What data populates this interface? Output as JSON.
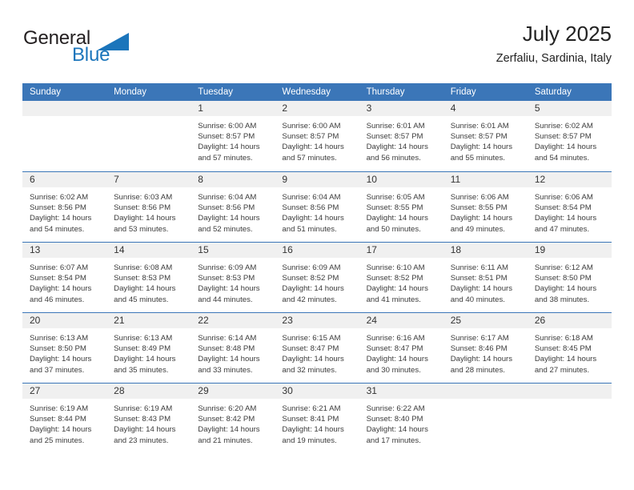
{
  "logo": {
    "word_top": "General",
    "word_bottom": "Blue",
    "triangle_color": "#1b75bb",
    "top_color": "#231f20",
    "bottom_color": "#1b75bb"
  },
  "header": {
    "title": "July 2025",
    "subtitle": "Zerfaliu, Sardinia, Italy"
  },
  "theme": {
    "header_blue": "#3b76b8",
    "day_band_gray": "#f0f0f0",
    "text": "#3b3b3b"
  },
  "weekdays": [
    "Sunday",
    "Monday",
    "Tuesday",
    "Wednesday",
    "Thursday",
    "Friday",
    "Saturday"
  ],
  "weeks": [
    [
      {
        "day": "",
        "sunrise": "",
        "sunset": "",
        "daylight_l1": "",
        "daylight_l2": ""
      },
      {
        "day": "",
        "sunrise": "",
        "sunset": "",
        "daylight_l1": "",
        "daylight_l2": ""
      },
      {
        "day": "1",
        "sunrise": "Sunrise: 6:00 AM",
        "sunset": "Sunset: 8:57 PM",
        "daylight_l1": "Daylight: 14 hours",
        "daylight_l2": "and 57 minutes."
      },
      {
        "day": "2",
        "sunrise": "Sunrise: 6:00 AM",
        "sunset": "Sunset: 8:57 PM",
        "daylight_l1": "Daylight: 14 hours",
        "daylight_l2": "and 57 minutes."
      },
      {
        "day": "3",
        "sunrise": "Sunrise: 6:01 AM",
        "sunset": "Sunset: 8:57 PM",
        "daylight_l1": "Daylight: 14 hours",
        "daylight_l2": "and 56 minutes."
      },
      {
        "day": "4",
        "sunrise": "Sunrise: 6:01 AM",
        "sunset": "Sunset: 8:57 PM",
        "daylight_l1": "Daylight: 14 hours",
        "daylight_l2": "and 55 minutes."
      },
      {
        "day": "5",
        "sunrise": "Sunrise: 6:02 AM",
        "sunset": "Sunset: 8:57 PM",
        "daylight_l1": "Daylight: 14 hours",
        "daylight_l2": "and 54 minutes."
      }
    ],
    [
      {
        "day": "6",
        "sunrise": "Sunrise: 6:02 AM",
        "sunset": "Sunset: 8:56 PM",
        "daylight_l1": "Daylight: 14 hours",
        "daylight_l2": "and 54 minutes."
      },
      {
        "day": "7",
        "sunrise": "Sunrise: 6:03 AM",
        "sunset": "Sunset: 8:56 PM",
        "daylight_l1": "Daylight: 14 hours",
        "daylight_l2": "and 53 minutes."
      },
      {
        "day": "8",
        "sunrise": "Sunrise: 6:04 AM",
        "sunset": "Sunset: 8:56 PM",
        "daylight_l1": "Daylight: 14 hours",
        "daylight_l2": "and 52 minutes."
      },
      {
        "day": "9",
        "sunrise": "Sunrise: 6:04 AM",
        "sunset": "Sunset: 8:56 PM",
        "daylight_l1": "Daylight: 14 hours",
        "daylight_l2": "and 51 minutes."
      },
      {
        "day": "10",
        "sunrise": "Sunrise: 6:05 AM",
        "sunset": "Sunset: 8:55 PM",
        "daylight_l1": "Daylight: 14 hours",
        "daylight_l2": "and 50 minutes."
      },
      {
        "day": "11",
        "sunrise": "Sunrise: 6:06 AM",
        "sunset": "Sunset: 8:55 PM",
        "daylight_l1": "Daylight: 14 hours",
        "daylight_l2": "and 49 minutes."
      },
      {
        "day": "12",
        "sunrise": "Sunrise: 6:06 AM",
        "sunset": "Sunset: 8:54 PM",
        "daylight_l1": "Daylight: 14 hours",
        "daylight_l2": "and 47 minutes."
      }
    ],
    [
      {
        "day": "13",
        "sunrise": "Sunrise: 6:07 AM",
        "sunset": "Sunset: 8:54 PM",
        "daylight_l1": "Daylight: 14 hours",
        "daylight_l2": "and 46 minutes."
      },
      {
        "day": "14",
        "sunrise": "Sunrise: 6:08 AM",
        "sunset": "Sunset: 8:53 PM",
        "daylight_l1": "Daylight: 14 hours",
        "daylight_l2": "and 45 minutes."
      },
      {
        "day": "15",
        "sunrise": "Sunrise: 6:09 AM",
        "sunset": "Sunset: 8:53 PM",
        "daylight_l1": "Daylight: 14 hours",
        "daylight_l2": "and 44 minutes."
      },
      {
        "day": "16",
        "sunrise": "Sunrise: 6:09 AM",
        "sunset": "Sunset: 8:52 PM",
        "daylight_l1": "Daylight: 14 hours",
        "daylight_l2": "and 42 minutes."
      },
      {
        "day": "17",
        "sunrise": "Sunrise: 6:10 AM",
        "sunset": "Sunset: 8:52 PM",
        "daylight_l1": "Daylight: 14 hours",
        "daylight_l2": "and 41 minutes."
      },
      {
        "day": "18",
        "sunrise": "Sunrise: 6:11 AM",
        "sunset": "Sunset: 8:51 PM",
        "daylight_l1": "Daylight: 14 hours",
        "daylight_l2": "and 40 minutes."
      },
      {
        "day": "19",
        "sunrise": "Sunrise: 6:12 AM",
        "sunset": "Sunset: 8:50 PM",
        "daylight_l1": "Daylight: 14 hours",
        "daylight_l2": "and 38 minutes."
      }
    ],
    [
      {
        "day": "20",
        "sunrise": "Sunrise: 6:13 AM",
        "sunset": "Sunset: 8:50 PM",
        "daylight_l1": "Daylight: 14 hours",
        "daylight_l2": "and 37 minutes."
      },
      {
        "day": "21",
        "sunrise": "Sunrise: 6:13 AM",
        "sunset": "Sunset: 8:49 PM",
        "daylight_l1": "Daylight: 14 hours",
        "daylight_l2": "and 35 minutes."
      },
      {
        "day": "22",
        "sunrise": "Sunrise: 6:14 AM",
        "sunset": "Sunset: 8:48 PM",
        "daylight_l1": "Daylight: 14 hours",
        "daylight_l2": "and 33 minutes."
      },
      {
        "day": "23",
        "sunrise": "Sunrise: 6:15 AM",
        "sunset": "Sunset: 8:47 PM",
        "daylight_l1": "Daylight: 14 hours",
        "daylight_l2": "and 32 minutes."
      },
      {
        "day": "24",
        "sunrise": "Sunrise: 6:16 AM",
        "sunset": "Sunset: 8:47 PM",
        "daylight_l1": "Daylight: 14 hours",
        "daylight_l2": "and 30 minutes."
      },
      {
        "day": "25",
        "sunrise": "Sunrise: 6:17 AM",
        "sunset": "Sunset: 8:46 PM",
        "daylight_l1": "Daylight: 14 hours",
        "daylight_l2": "and 28 minutes."
      },
      {
        "day": "26",
        "sunrise": "Sunrise: 6:18 AM",
        "sunset": "Sunset: 8:45 PM",
        "daylight_l1": "Daylight: 14 hours",
        "daylight_l2": "and 27 minutes."
      }
    ],
    [
      {
        "day": "27",
        "sunrise": "Sunrise: 6:19 AM",
        "sunset": "Sunset: 8:44 PM",
        "daylight_l1": "Daylight: 14 hours",
        "daylight_l2": "and 25 minutes."
      },
      {
        "day": "28",
        "sunrise": "Sunrise: 6:19 AM",
        "sunset": "Sunset: 8:43 PM",
        "daylight_l1": "Daylight: 14 hours",
        "daylight_l2": "and 23 minutes."
      },
      {
        "day": "29",
        "sunrise": "Sunrise: 6:20 AM",
        "sunset": "Sunset: 8:42 PM",
        "daylight_l1": "Daylight: 14 hours",
        "daylight_l2": "and 21 minutes."
      },
      {
        "day": "30",
        "sunrise": "Sunrise: 6:21 AM",
        "sunset": "Sunset: 8:41 PM",
        "daylight_l1": "Daylight: 14 hours",
        "daylight_l2": "and 19 minutes."
      },
      {
        "day": "31",
        "sunrise": "Sunrise: 6:22 AM",
        "sunset": "Sunset: 8:40 PM",
        "daylight_l1": "Daylight: 14 hours",
        "daylight_l2": "and 17 minutes."
      },
      {
        "day": "",
        "sunrise": "",
        "sunset": "",
        "daylight_l1": "",
        "daylight_l2": ""
      },
      {
        "day": "",
        "sunrise": "",
        "sunset": "",
        "daylight_l1": "",
        "daylight_l2": ""
      }
    ]
  ]
}
